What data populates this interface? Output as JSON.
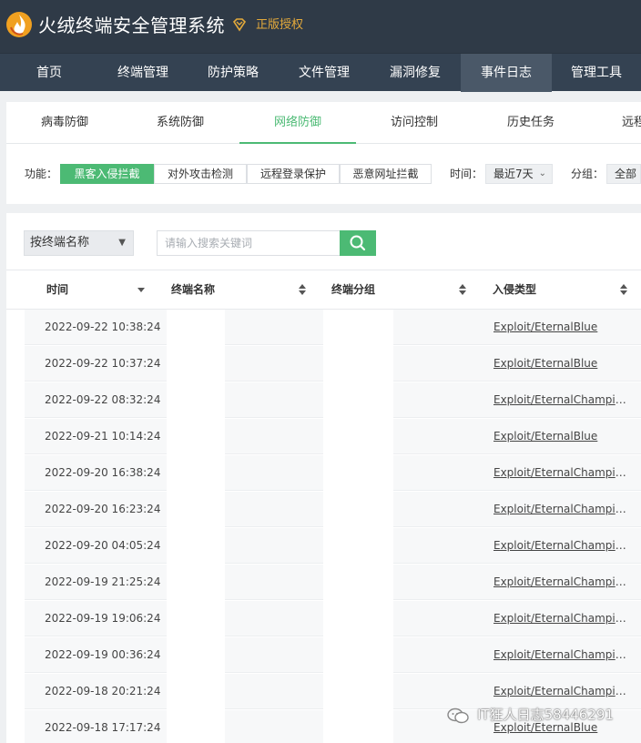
{
  "app": {
    "title": "火绒终端安全管理系统",
    "license": "正版授权",
    "logo_icon": "huorong-flame-logo",
    "badge_icon": "diamond-badge-icon"
  },
  "nav": [
    "首页",
    "终端管理",
    "防护策略",
    "文件管理",
    "漏洞修复",
    "事件日志",
    "管理工具"
  ],
  "nav_active": "事件日志",
  "tabs": [
    "病毒防御",
    "系统防御",
    "网络防御",
    "访问控制",
    "历史任务",
    "远程"
  ],
  "tab_active": "网络防御",
  "filters": {
    "function_label": "功能：",
    "function_buttons": [
      "黑客入侵拦截",
      "对外攻击检测",
      "远程登录保护",
      "恶意网址拦截"
    ],
    "function_active": "黑客入侵拦截",
    "time_label": "时间：",
    "time_value": "最近7天",
    "group_label": "分组：",
    "group_value": "全部"
  },
  "search": {
    "select_value": "按终端名称",
    "placeholder": "请输入搜索关键词",
    "button_icon": "search-icon"
  },
  "table": {
    "headers": [
      "时间",
      "终端名称",
      "终端分组",
      "入侵类型"
    ],
    "rows": [
      {
        "time": "2022-09-22 10:38:24",
        "type": "Exploit/EternalBlue"
      },
      {
        "time": "2022-09-22 10:37:24",
        "type": "Exploit/EternalBlue"
      },
      {
        "time": "2022-09-22 08:32:24",
        "type": "Exploit/EternalChampio..."
      },
      {
        "time": "2022-09-21 10:14:24",
        "type": "Exploit/EternalBlue"
      },
      {
        "time": "2022-09-20 16:38:24",
        "type": "Exploit/EternalChampio..."
      },
      {
        "time": "2022-09-20 16:23:24",
        "type": "Exploit/EternalChampio..."
      },
      {
        "time": "2022-09-20 04:05:24",
        "type": "Exploit/EternalChampio..."
      },
      {
        "time": "2022-09-19 21:25:24",
        "type": "Exploit/EternalChampio..."
      },
      {
        "time": "2022-09-19 19:06:24",
        "type": "Exploit/EternalChampio..."
      },
      {
        "time": "2022-09-19 00:36:24",
        "type": "Exploit/EternalChampio..."
      },
      {
        "time": "2022-09-18 20:21:24",
        "type": "Exploit/EternalChampio..."
      },
      {
        "time": "2022-09-18 17:17:24",
        "type": "Exploit/EternalBlue"
      }
    ]
  },
  "watermark": {
    "text": "IT狂人日志58446291",
    "icon": "wechat-icon"
  },
  "colors": {
    "header_bg": "#2f3a47",
    "nav_bg": "#344252",
    "accent_green": "#4cba74",
    "license_gold": "#e3a93b"
  }
}
